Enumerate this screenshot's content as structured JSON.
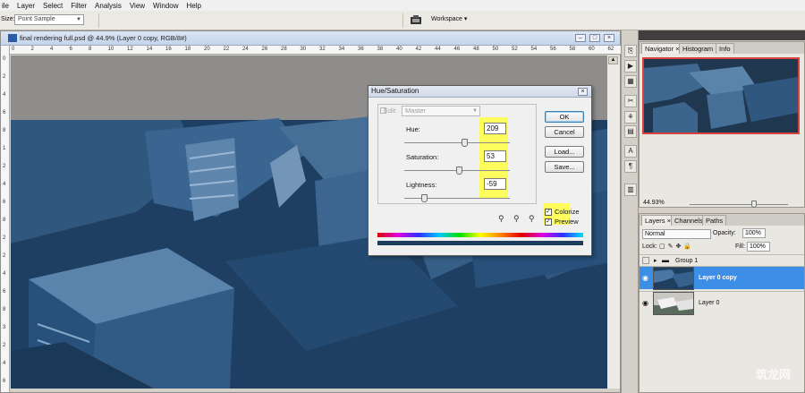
{
  "menu": [
    "ile",
    "Layer",
    "Select",
    "Filter",
    "Analysis",
    "View",
    "Window",
    "Help"
  ],
  "options": {
    "size_label": "Size:",
    "size_value": "Point Sample",
    "workspace_label": "Workspace ▾"
  },
  "document": {
    "title": "final rendering full.psd @ 44.9% (Layer 0 copy, RGB/8#)",
    "ruler_top": [
      "0",
      "2",
      "4",
      "6",
      "8",
      "10",
      "12",
      "14",
      "16",
      "18",
      "20",
      "22",
      "24",
      "26",
      "28",
      "30",
      "32",
      "34",
      "36",
      "38",
      "40",
      "42",
      "44",
      "46",
      "48",
      "50",
      "52",
      "54",
      "56",
      "58",
      "60",
      "62"
    ],
    "ruler_left": [
      "0",
      "2",
      "4",
      "6",
      "8",
      "1",
      "2",
      "4",
      "6",
      "8",
      "2",
      "2",
      "4",
      "6",
      "8",
      "3",
      "2",
      "4",
      "6"
    ]
  },
  "dialog": {
    "title": "Hue/Saturation",
    "edit_label": "Edit:",
    "edit_value": "Master",
    "hue_label": "Hue:",
    "hue_value": "209",
    "saturation_label": "Saturation:",
    "saturation_value": "53",
    "lightness_label": "Lightness:",
    "lightness_value": "-59",
    "ok": "OK",
    "cancel": "Cancel",
    "load": "Load...",
    "save": "Save...",
    "colorize": "Colorize",
    "preview": "Preview",
    "colorize_checked": true,
    "preview_checked": true,
    "colors": {
      "highlight": "#fdfd5e",
      "tint": "#1e3f61"
    }
  },
  "navigator": {
    "tabs": [
      "Navigator ×",
      "Histogram",
      "Info"
    ],
    "zoom": "44.93%"
  },
  "layers": {
    "tabs": [
      "Layers ×",
      "Channels",
      "Paths"
    ],
    "blend_mode": "Normal",
    "opacity_label": "Opacity:",
    "opacity_value": "100%",
    "lock_label": "Lock:",
    "fill_label": "Fill:",
    "fill_value": "100%",
    "items": [
      {
        "name": "Group 1",
        "selected": false
      },
      {
        "name": "Layer 0 copy",
        "selected": true
      },
      {
        "name": "Layer 0",
        "selected": false
      }
    ]
  },
  "watermark": "筑龙网"
}
